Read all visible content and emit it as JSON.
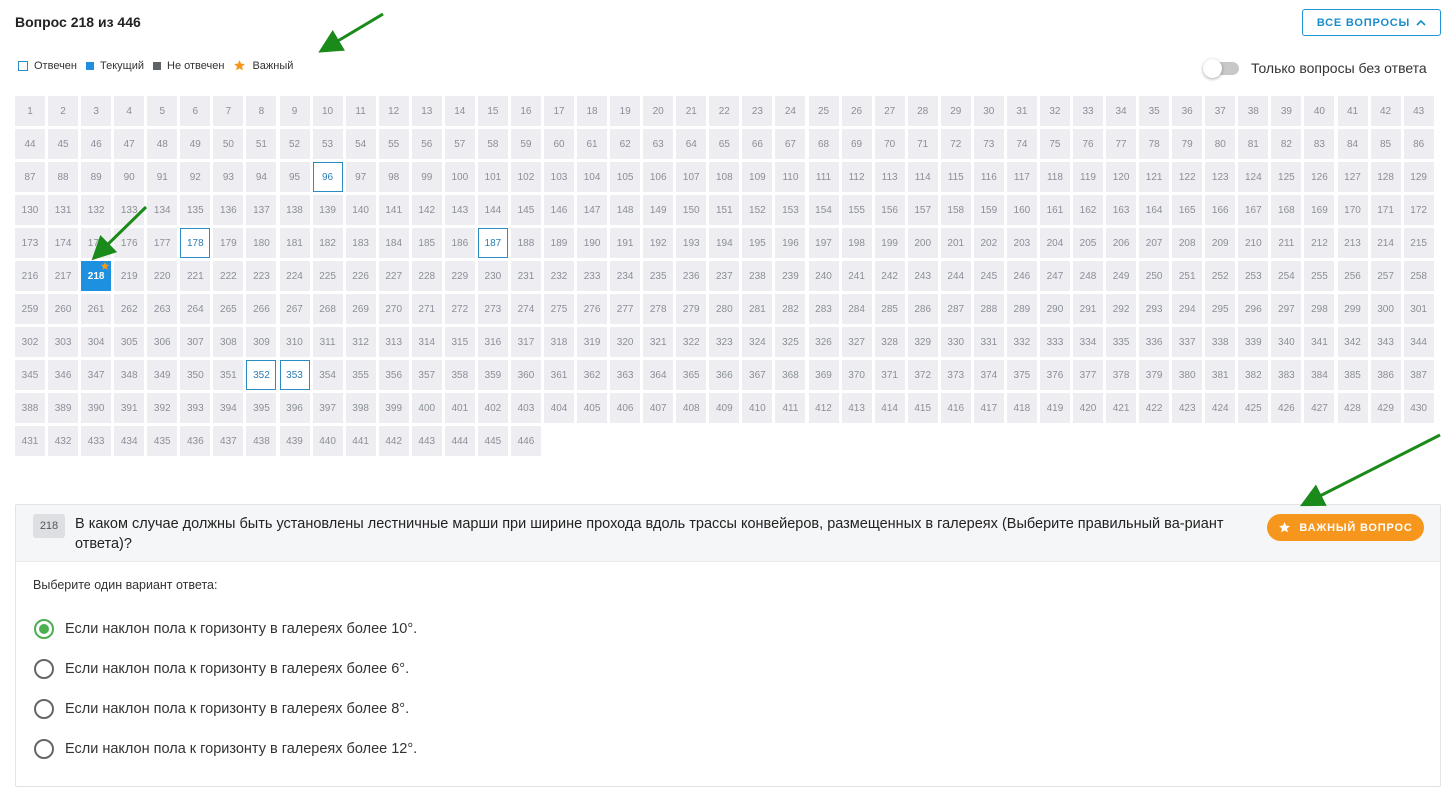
{
  "header": {
    "title": "Вопрос 218 из 446",
    "all_questions_label": "ВСЕ ВОПРОСЫ"
  },
  "legend": {
    "answered": "Отвечен",
    "current": "Текущий",
    "unanswered": "Не отвечен",
    "important": "Важный"
  },
  "filter": {
    "label": "Только вопросы без ответа",
    "enabled": false
  },
  "grid": {
    "total": 446,
    "current": 218,
    "answered": [
      96,
      178,
      187,
      352,
      353
    ],
    "important": [
      218
    ]
  },
  "question": {
    "number": "218",
    "text": "В каком случае должны быть установлены лестничные марши при ширине прохода вдоль трассы конвейеров, размещенных в галереях (Выберите правильный ва-риант ответа)?",
    "important_label": "ВАЖНЫЙ ВОПРОС",
    "instruction": "Выберите один вариант ответа:",
    "options": [
      {
        "label": "Если наклон пола к горизонту в галереях более 10°.",
        "checked": true
      },
      {
        "label": "Если наклон пола к горизонту в галереях более 6°.",
        "checked": false
      },
      {
        "label": "Если наклон пола к горизонту в галереях более 8°.",
        "checked": false
      },
      {
        "label": "Если наклон пола к горизонту в галереях более 12°.",
        "checked": false
      }
    ]
  },
  "colors": {
    "accent": "#1e90e0",
    "answered_border": "#2b8bc2",
    "important": "#f7961c",
    "selected_radio": "#4caf50",
    "annotation_arrow": "#1a8a1a"
  }
}
